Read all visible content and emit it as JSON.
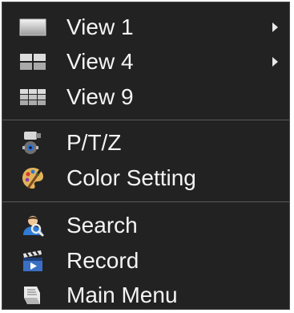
{
  "menu": {
    "view1": {
      "label": "View 1",
      "icon": "single-view-icon"
    },
    "view4": {
      "label": "View 4",
      "icon": "quad-view-icon"
    },
    "view9": {
      "label": "View 9",
      "icon": "nine-view-icon"
    },
    "ptz": {
      "label": "P/T/Z",
      "icon": "ptz-camera-icon"
    },
    "color": {
      "label": "Color Setting",
      "icon": "palette-icon"
    },
    "search": {
      "label": "Search",
      "icon": "search-person-icon"
    },
    "record": {
      "label": "Record",
      "icon": "clapperboard-icon"
    },
    "main": {
      "label": "Main Menu",
      "icon": "main-menu-icon"
    }
  },
  "colors": {
    "background": "#222222",
    "text": "#f4f4f4",
    "separator": "#5a5a5a"
  }
}
